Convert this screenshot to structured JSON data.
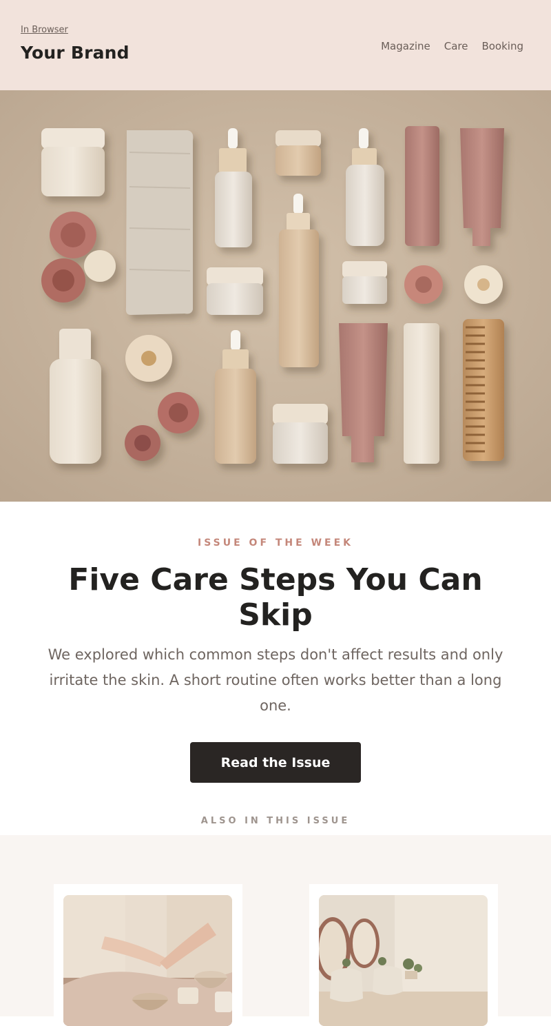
{
  "header": {
    "browser_link": "In Browser",
    "brand": "Your Brand",
    "nav": [
      "Magazine",
      "Care",
      "Booking"
    ]
  },
  "hero": {
    "image": "flat-lay of skincare bottles, jars, tubes, linen towel, dried roses and a wooden comb on beige stone"
  },
  "feature": {
    "kicker": "ISSUE OF THE WEEK",
    "title": "Five Care Steps You Can Skip",
    "text": "We explored which common steps don't affect results and only irritate the skin. A short routine often works better than a long one.",
    "cta": "Read the Issue"
  },
  "also_label": "ALSO IN THIS ISSUE",
  "cards": [
    {
      "image": "hands massage with cream jars and bowls"
    },
    {
      "image": "salon interior with round mirrors and armchairs"
    }
  ],
  "colors": {
    "header_bg": "#f2e3dc",
    "accent": "#c4877a",
    "button_bg": "#2a2624",
    "muted_text": "#6e6560",
    "cards_bg": "#f9f5f2"
  }
}
